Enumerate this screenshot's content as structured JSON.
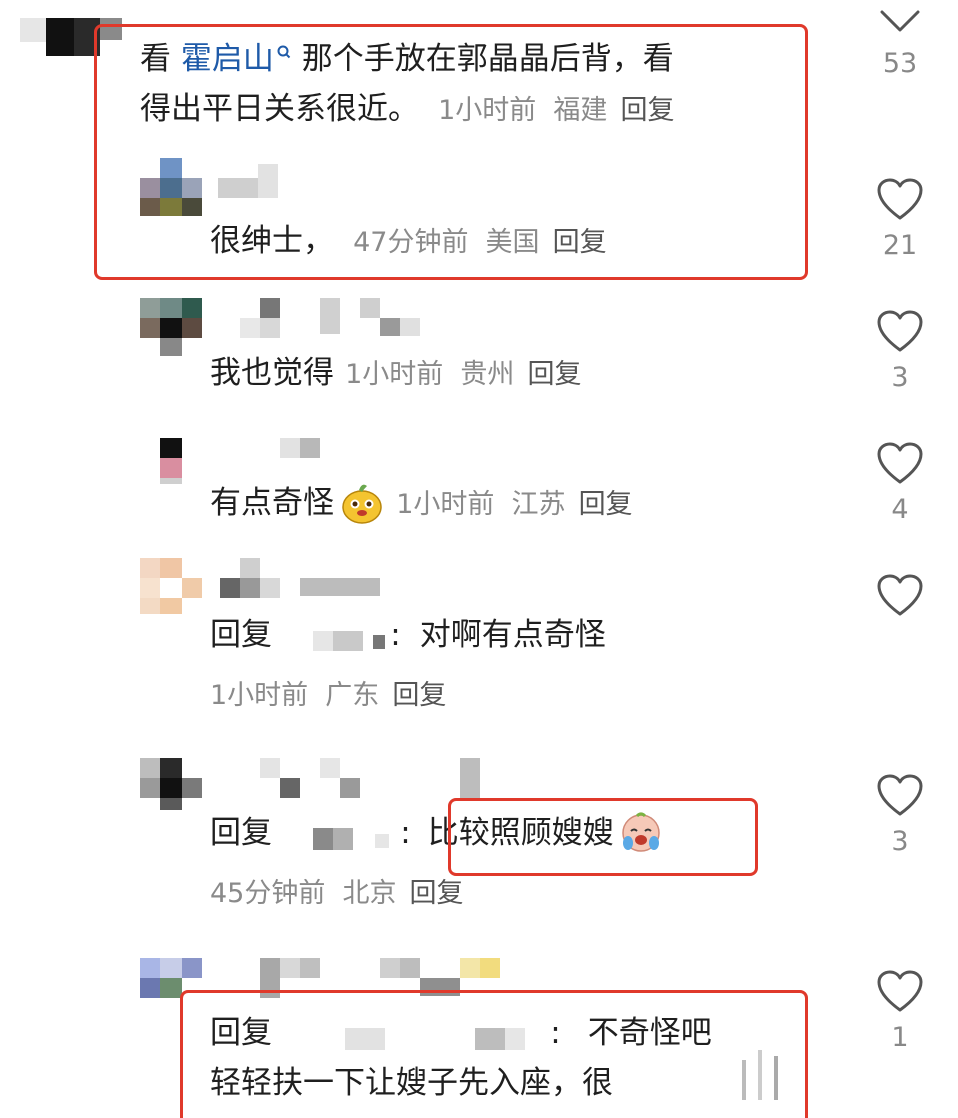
{
  "comments": [
    {
      "text_prefix": "看",
      "mention": "霍启山",
      "text_line1_rest": "那个手放在郭晶晶后背，看",
      "text_line2": "得出平日关系很近。",
      "time": "1小时前",
      "location": "福建",
      "reply": "回复",
      "likes": "53"
    },
    {
      "text": "很绅士，",
      "time": "47分钟前",
      "location": "美国",
      "reply": "回复",
      "likes": "21"
    },
    {
      "text": "我也觉得",
      "time": "1小时前",
      "location": "贵州",
      "reply": "回复",
      "likes": "3"
    },
    {
      "text": "有点奇怪",
      "time": "1小时前",
      "location": "江苏",
      "reply": "回复",
      "likes": "4"
    },
    {
      "reply_prefix": "回复",
      "text": "对啊有点奇怪",
      "time": "1小时前",
      "location": "广东",
      "reply": "回复"
    },
    {
      "reply_prefix": "回复",
      "text": "比较照顾嫂嫂",
      "time": "45分钟前",
      "location": "北京",
      "reply": "回复",
      "likes": "3"
    },
    {
      "reply_prefix": "回复",
      "text": "不奇怪吧",
      "text_line2": "轻轻扶一下让嫂子先入座，很",
      "likes": "1"
    }
  ],
  "colon": ":",
  "colors": {
    "highlight": "#e0392b",
    "mention": "#1e5aa8"
  },
  "icons": [
    "chevron-down-icon",
    "heart-icon",
    "search-icon",
    "pear-emoji",
    "crying-emoji"
  ]
}
